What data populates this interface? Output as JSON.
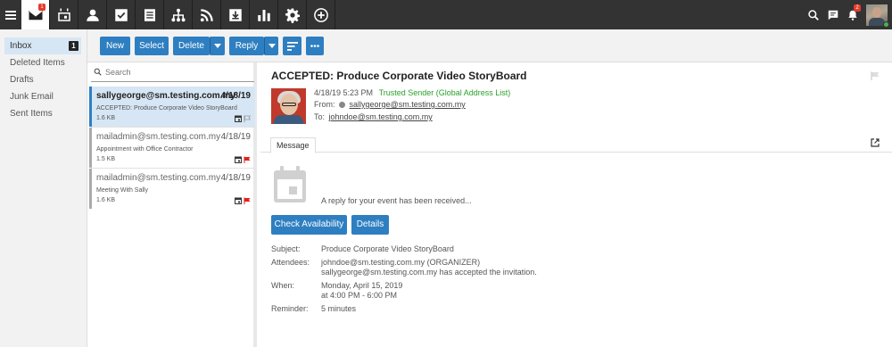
{
  "topbar": {
    "apps": [
      {
        "name": "mail",
        "badge": "1"
      },
      {
        "name": "calendar",
        "badge": ""
      },
      {
        "name": "contacts",
        "badge": ""
      },
      {
        "name": "tasks",
        "badge": ""
      },
      {
        "name": "notes",
        "badge": ""
      },
      {
        "name": "organization",
        "badge": ""
      },
      {
        "name": "rss",
        "badge": ""
      },
      {
        "name": "file-storage",
        "badge": ""
      },
      {
        "name": "reports",
        "badge": ""
      },
      {
        "name": "settings",
        "badge": ""
      },
      {
        "name": "add",
        "badge": ""
      }
    ],
    "notifications_badge": "2"
  },
  "folders": [
    {
      "label": "Inbox",
      "count": "1"
    },
    {
      "label": "Deleted Items",
      "count": ""
    },
    {
      "label": "Drafts",
      "count": ""
    },
    {
      "label": "Junk Email",
      "count": ""
    },
    {
      "label": "Sent Items",
      "count": ""
    }
  ],
  "toolbar": {
    "new": "New",
    "select": "Select",
    "delete": "Delete",
    "reply": "Reply"
  },
  "search": {
    "placeholder": "Search"
  },
  "messages": [
    {
      "from": "sallygeorge@sm.testing.com.my",
      "date": "4/18/19",
      "subject": "ACCEPTED: Produce Corporate Video StoryBoard",
      "size": "1.6 KB",
      "flag": "none"
    },
    {
      "from": "mailadmin@sm.testing.com.my",
      "date": "4/18/19",
      "subject": "Appointment with Office Contractor",
      "size": "1.5 KB",
      "flag": "red"
    },
    {
      "from": "mailadmin@sm.testing.com.my",
      "date": "4/18/19",
      "subject": "Meeting With Sally",
      "size": "1.6 KB",
      "flag": "red"
    }
  ],
  "reading": {
    "title": "ACCEPTED: Produce Corporate Video StoryBoard",
    "datetime": "4/18/19 5:23 PM",
    "trusted": "Trusted Sender (Global Address List)",
    "from_label": "From:",
    "from_addr": "sallygeorge@sm.testing.com.my",
    "to_label": "To:",
    "to_addr": "johndoe@sm.testing.com.my",
    "tab": "Message",
    "reply_text": "A reply for your event has been received...",
    "check_availability": "Check Availability",
    "details": "Details",
    "fields": {
      "subject_label": "Subject:",
      "subject": "Produce Corporate Video StoryBoard",
      "attendees_label": "Attendees:",
      "attendees_1": "johndoe@sm.testing.com.my (ORGANIZER)",
      "attendees_2": "sallygeorge@sm.testing.com.my has accepted the invitation.",
      "when_label": "When:",
      "when_1": "Monday, April 15, 2019",
      "when_2": "at 4:00 PM - 6:00 PM",
      "reminder_label": "Reminder:",
      "reminder": "5 minutes"
    }
  },
  "colors": {
    "accent": "#2e7fc1",
    "topbar": "#333333",
    "selected": "#d6e6f4",
    "trusted": "#2aa02a",
    "flag": "#e0221b"
  }
}
